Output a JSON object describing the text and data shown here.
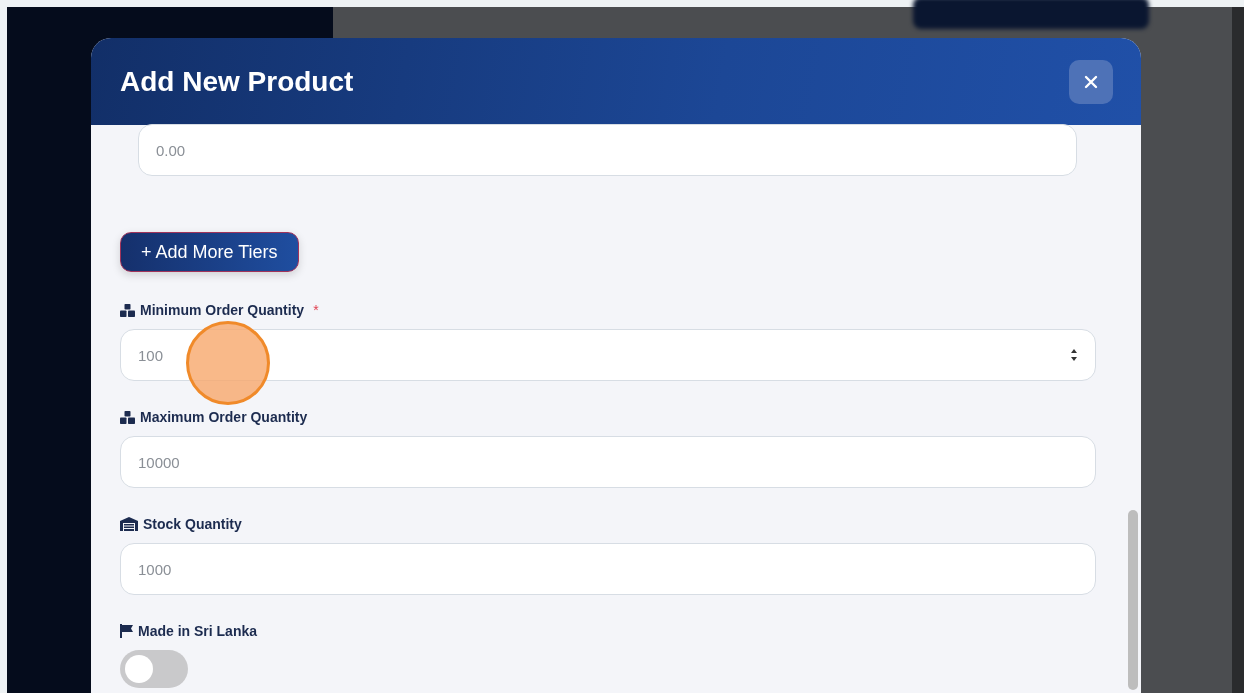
{
  "modal": {
    "title": "Add New Product",
    "tier_field": {
      "placeholder": "0.00"
    },
    "add_tier_button": {
      "label": "+ Add More Tiers"
    },
    "fields": [
      {
        "kind": "order",
        "label": "Minimum Order Quantity",
        "required_mark": "*",
        "placeholder": "100",
        "hovered": true
      },
      {
        "kind": "order",
        "label": "Maximum Order Quantity",
        "placeholder": "10000",
        "hovered": false
      },
      {
        "kind": "stock",
        "label": "Stock Quantity",
        "placeholder": "1000",
        "hovered": false
      }
    ],
    "toggle": {
      "label": "Made in Sri Lanka",
      "on": false
    }
  }
}
